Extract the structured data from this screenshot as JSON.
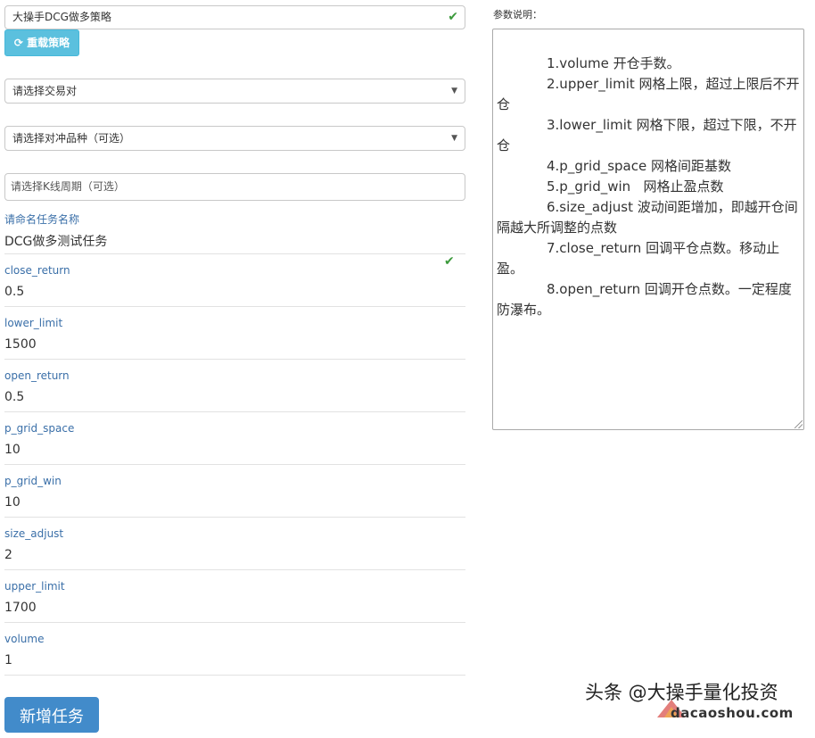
{
  "strategy": {
    "value": "大操手DCG做多策略",
    "check_icon": "check-icon"
  },
  "reload_button": {
    "label": "重载策略",
    "icon": "refresh-icon"
  },
  "selects": {
    "pair": "请选择交易对",
    "hedge": "请选择对冲品种（可选）"
  },
  "kline_period": {
    "placeholder": "请选择K线周期（可选）"
  },
  "task_name": {
    "label": "请命名任务名称",
    "value": "DCG做多测试任务"
  },
  "params": [
    {
      "label": "close_return",
      "value": "0.5"
    },
    {
      "label": "lower_limit",
      "value": "1500"
    },
    {
      "label": "open_return",
      "value": "0.5"
    },
    {
      "label": "p_grid_space",
      "value": "10"
    },
    {
      "label": "p_grid_win",
      "value": "10"
    },
    {
      "label": "size_adjust",
      "value": "2"
    },
    {
      "label": "upper_limit",
      "value": "1700"
    },
    {
      "label": "volume",
      "value": "1"
    }
  ],
  "add_button": {
    "label": "新增任务"
  },
  "help": {
    "title": "参数说明：",
    "lines": [
      "1.volume 开仓手数。",
      "2.upper_limit 网格上限，超过上限后不开仓",
      "3.lower_limit 网格下限，超过下限，不开仓",
      "4.p_grid_space 网格间距基数",
      "5.p_grid_win   网格止盈点数",
      "6.size_adjust  波动间距增加，即越开仓间隔越大所调整的点数",
      "7.close_return 回调平仓点数。移动止盈。",
      "8.open_return  回调开仓点数。一定程度防瀑布。"
    ]
  },
  "watermark": {
    "text": "头条 @大操手量化投资",
    "site": "dacaoshou.com"
  }
}
